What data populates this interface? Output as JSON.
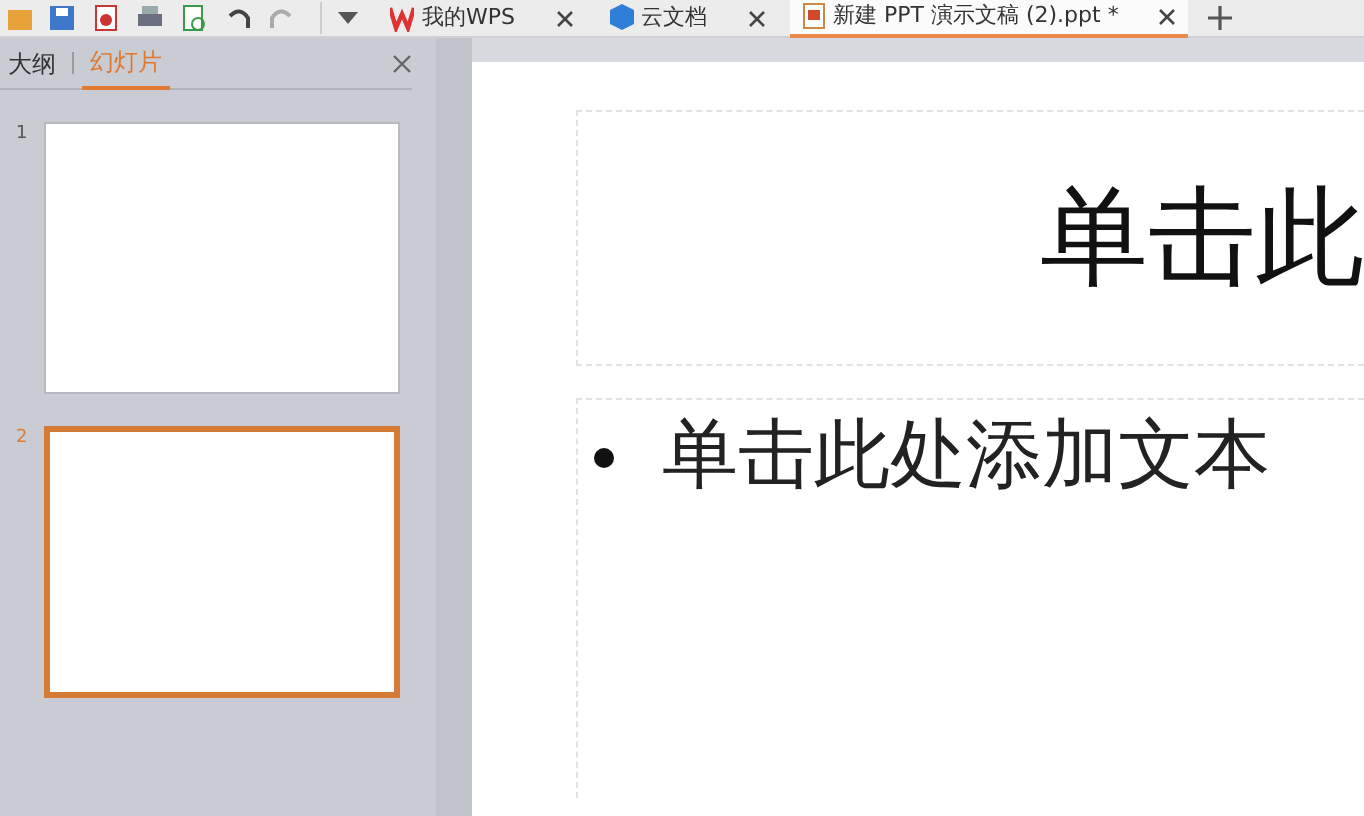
{
  "tabs": [
    {
      "label": "我的WPS",
      "kind": "wps",
      "selected": false
    },
    {
      "label": "云文档",
      "kind": "cloud",
      "selected": false
    },
    {
      "label": "新建 PPT 演示文稿 (2).ppt *",
      "kind": "ppt",
      "selected": true
    }
  ],
  "panel": {
    "tabs": [
      {
        "label": "大纲",
        "selected": false
      },
      {
        "label": "幻灯片",
        "selected": true
      }
    ],
    "slides": [
      {
        "number": "1",
        "selected": false
      },
      {
        "number": "2",
        "selected": true
      }
    ]
  },
  "slide": {
    "title": "单击此",
    "body": "单击此处添加文本"
  }
}
